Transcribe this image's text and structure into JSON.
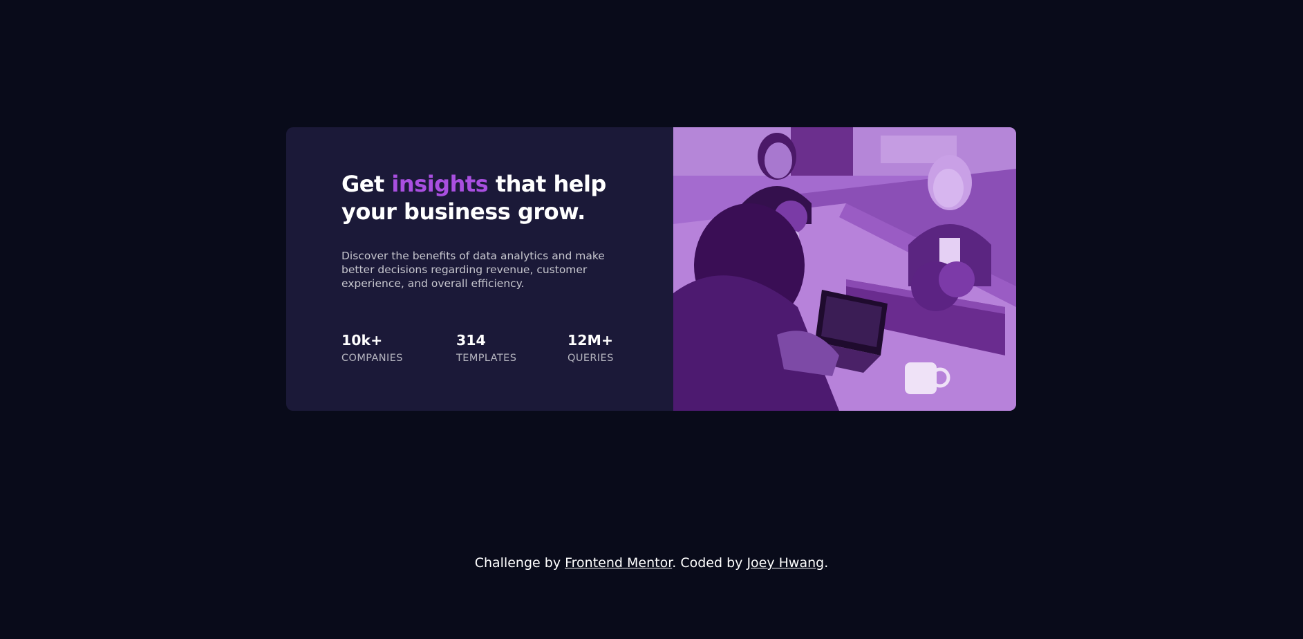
{
  "card": {
    "heading": {
      "before": "Get ",
      "accent": "insights",
      "after": " that help your business grow."
    },
    "description": "Discover the benefits of data analytics and make better decisions regarding revenue, customer experience, and overall efficiency.",
    "stats": [
      {
        "value": "10k+",
        "label": "COMPANIES"
      },
      {
        "value": "314",
        "label": "TEMPLATES"
      },
      {
        "value": "12M+",
        "label": "QUERIES"
      }
    ]
  },
  "footer": {
    "prefix": "Challenge by ",
    "link1": "Frontend Mentor",
    "middle": ". Coded by ",
    "link2": "Joey Hwang",
    "suffix": "."
  },
  "colors": {
    "background": "#090b1a",
    "card": "#1b1938",
    "accent": "#a94fe0",
    "image_tint": "#9c5ac9"
  }
}
